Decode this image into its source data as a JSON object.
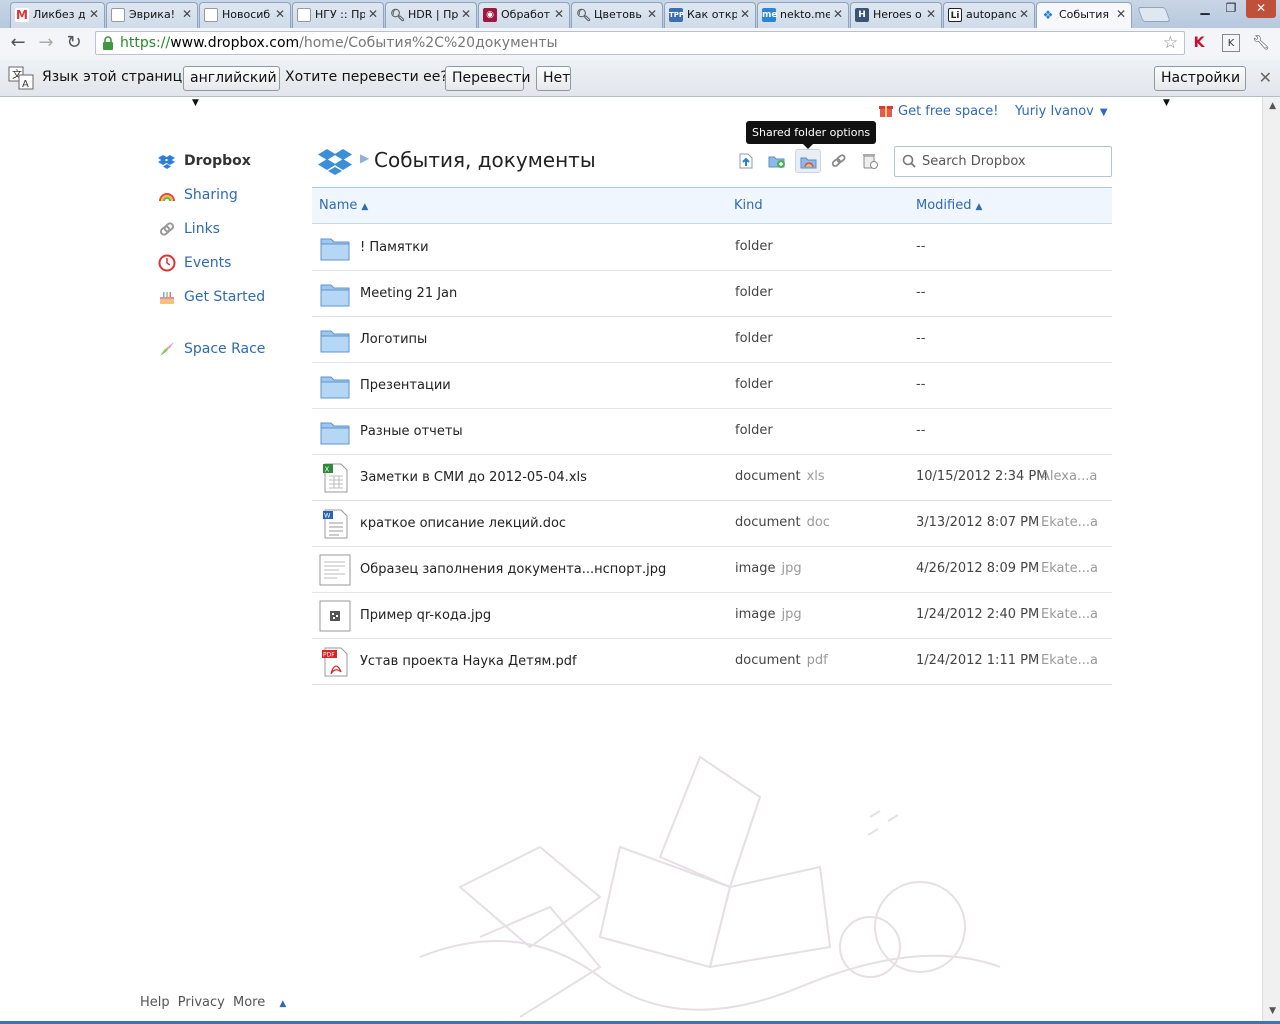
{
  "browser": {
    "tabs": [
      {
        "title": "Ликбез д",
        "favicon": "gmail-icon",
        "color": "#d33"
      },
      {
        "title": "Эврика!",
        "favicon": "page-icon",
        "color": "#999"
      },
      {
        "title": "Новосиб",
        "favicon": "page-icon",
        "color": "#999"
      },
      {
        "title": "НГУ :: Пр",
        "favicon": "page-icon",
        "color": "#999"
      },
      {
        "title": "HDR | Пр",
        "favicon": "magnifier-icon",
        "color": "#999"
      },
      {
        "title": "Обработ",
        "favicon": "camera-icon",
        "color": "#a0183c"
      },
      {
        "title": "Цветовь",
        "favicon": "magnifier-icon",
        "color": "#999"
      },
      {
        "title": "Как откр",
        "favicon": "tpp-icon",
        "color": "#3b6fb0"
      },
      {
        "title": "nekto.me",
        "favicon": "me-icon",
        "color": "#2a84d8"
      },
      {
        "title": "Heroes o",
        "favicon": "heroes-icon",
        "color": "#3a5573"
      },
      {
        "title": "autopanc",
        "favicon": "li-icon",
        "color": "#222"
      },
      {
        "title": "События",
        "favicon": "dropbox-icon",
        "color": "#2a7fd4"
      }
    ],
    "url": {
      "scheme": "https://",
      "host": "www.dropbox.com",
      "path": "/home/События%2C%20документы"
    }
  },
  "translate_bar": {
    "page_language_label": "Язык этой страницы",
    "language_value": "английский",
    "question": "Хотите перевести ее?",
    "translate_button": "Перевести",
    "no_button": "Нет",
    "settings_button": "Настройки"
  },
  "header": {
    "free_space_link": "Get free space!",
    "user_name": "Yuriy Ivanov"
  },
  "tooltip": {
    "text": "Shared folder options"
  },
  "sidebar": {
    "items": [
      {
        "label": "Dropbox",
        "icon": "dropbox-icon"
      },
      {
        "label": "Sharing",
        "icon": "rainbow-icon"
      },
      {
        "label": "Links",
        "icon": "link-icon"
      },
      {
        "label": "Events",
        "icon": "clock-icon"
      },
      {
        "label": "Get Started",
        "icon": "cake-icon"
      },
      {
        "label": "Space Race",
        "icon": "rocket-icon"
      }
    ]
  },
  "breadcrumb": {
    "title": "События, документы"
  },
  "search": {
    "placeholder": "Search Dropbox"
  },
  "table": {
    "columns": {
      "name": "Name",
      "kind": "Kind",
      "modified": "Modified"
    },
    "rows": [
      {
        "name": "! Памятки",
        "kind": "folder",
        "ext": "",
        "modified": "--",
        "by": "",
        "icon": "folder-icon"
      },
      {
        "name": "Meeting 21 Jan",
        "kind": "folder",
        "ext": "",
        "modified": "--",
        "by": "",
        "icon": "folder-icon"
      },
      {
        "name": "Логотипы",
        "kind": "folder",
        "ext": "",
        "modified": "--",
        "by": "",
        "icon": "folder-icon"
      },
      {
        "name": "Презентации",
        "kind": "folder",
        "ext": "",
        "modified": "--",
        "by": "",
        "icon": "folder-icon"
      },
      {
        "name": "Разные отчеты",
        "kind": "folder",
        "ext": "",
        "modified": "--",
        "by": "",
        "icon": "folder-icon"
      },
      {
        "name": "Заметки в СМИ до 2012-05-04.xls",
        "kind": "document",
        "ext": "xls",
        "modified": "10/15/2012 2:34 PM",
        "by": "Alexa...a",
        "icon": "spreadsheet-icon"
      },
      {
        "name": "краткое описание лекций.doc",
        "kind": "document",
        "ext": "doc",
        "modified": "3/13/2012 8:07 PM",
        "by": "Ekate...a",
        "icon": "word-doc-icon"
      },
      {
        "name": "Образец заполнения документа...нспорт.jpg",
        "kind": "image",
        "ext": "jpg",
        "modified": "4/26/2012 8:09 PM",
        "by": "Ekate...a",
        "icon": "image-thumbnail-icon"
      },
      {
        "name": "Пример qr-кода.jpg",
        "kind": "image",
        "ext": "jpg",
        "modified": "1/24/2012 2:40 PM",
        "by": "Ekate...a",
        "icon": "qr-thumbnail-icon"
      },
      {
        "name": "Устав проекта Наука Детям.pdf",
        "kind": "document",
        "ext": "pdf",
        "modified": "1/24/2012 1:11 PM",
        "by": "Ekate...a",
        "icon": "pdf-icon"
      }
    ]
  },
  "footer": {
    "help": "Help",
    "privacy": "Privacy",
    "more": "More"
  },
  "colors": {
    "link": "#2f6ab3",
    "table_header_bg": "#f0f6fd",
    "folder": "#7fb2e5"
  }
}
